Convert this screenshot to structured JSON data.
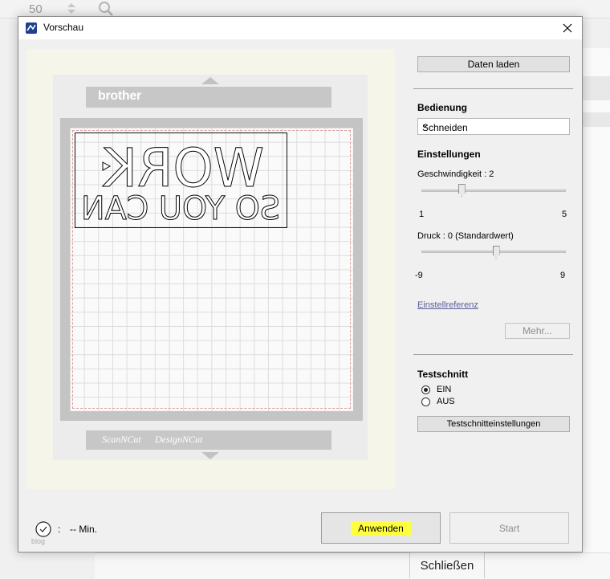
{
  "background": {
    "zoom_value": "50",
    "close_label": "Schließen"
  },
  "dialog": {
    "title": "Vorschau",
    "icons": {
      "app": "scanncut-app-icon",
      "close": "close-icon"
    }
  },
  "preview": {
    "brand_text": "brother",
    "bottom_left": "ScanNCut",
    "bottom_right": "DesignNCut",
    "design_lines": [
      "WORK",
      "SO YOU CAN"
    ]
  },
  "panel": {
    "load_data_label": "Daten laden",
    "operation_heading": "Bedienung",
    "operation_value": "Schneiden",
    "settings_heading": "Einstellungen",
    "speed_label": "Geschwindigkeit : 2",
    "speed_min": "1",
    "speed_max": "5",
    "speed_value": 2,
    "pressure_label": "Druck : 0 (Standardwert)",
    "pressure_min": "-9",
    "pressure_max": "9",
    "pressure_value": 0,
    "reference_link": "Einstellreferenz",
    "more_label": "Mehr...",
    "test_heading": "Testschnitt",
    "test_on_label": "EIN",
    "test_off_label": "AUS",
    "test_selected": "EIN",
    "test_settings_label": "Testschnitteinstellungen"
  },
  "footer": {
    "time_separator": ":",
    "time_value": "-- Min.",
    "apply_label": "Anwenden",
    "start_label": "Start",
    "watermark": "blog"
  },
  "colors": {
    "highlight": "#ffff40",
    "accent_icon": "#1f3f8f"
  }
}
